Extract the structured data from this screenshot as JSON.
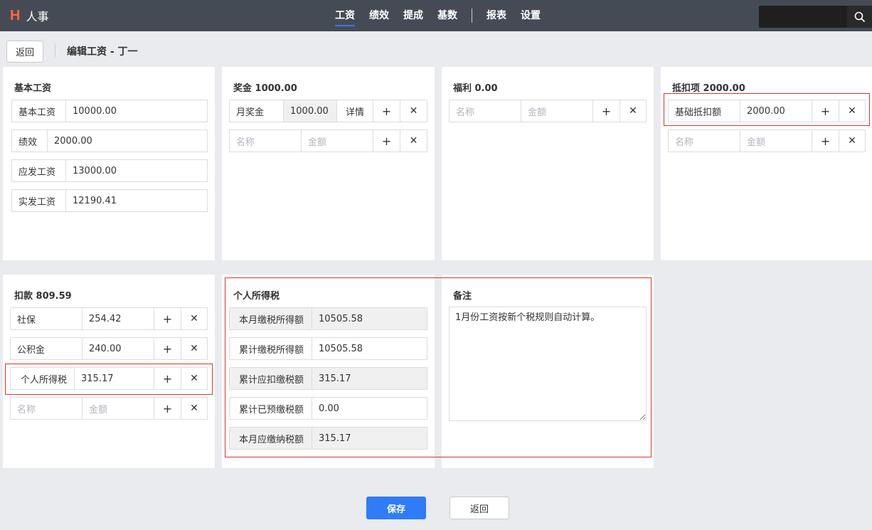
{
  "app": {
    "logo": "H",
    "name": "人事"
  },
  "nav": {
    "items": [
      "工资",
      "绩效",
      "提成",
      "基数"
    ],
    "items2": [
      "报表",
      "设置"
    ]
  },
  "header": {
    "back_label": "返回",
    "title": "编辑工资 - 丁一"
  },
  "basic": {
    "title": "基本工资",
    "rows": [
      {
        "label": "基本工资",
        "value": "10000.00"
      },
      {
        "label": "绩效",
        "value": "2000.00"
      },
      {
        "label": "应发工资",
        "value": "13000.00"
      },
      {
        "label": "实发工资",
        "value": "12190.41"
      }
    ]
  },
  "bonus": {
    "title": "奖金 1000.00",
    "item": {
      "name": "月奖金",
      "amount": "1000.00",
      "detail": "详情"
    },
    "new_name_ph": "名称",
    "new_amount_ph": "金额"
  },
  "welfare": {
    "title": "福利 0.00",
    "new_name_ph": "名称",
    "new_amount_ph": "金额"
  },
  "deductible": {
    "title": "抵扣项 2000.00",
    "item": {
      "name": "基础抵扣额",
      "amount": "2000.00"
    },
    "new_name_ph": "名称",
    "new_amount_ph": "金额"
  },
  "deduction": {
    "title": "扣款 809.59",
    "rows": [
      {
        "name": "社保",
        "amount": "254.42"
      },
      {
        "name": "公积金",
        "amount": "240.00"
      },
      {
        "name": "个人所得税",
        "amount": "315.17"
      }
    ],
    "new_name_ph": "名称",
    "new_amount_ph": "金额"
  },
  "tax": {
    "title": "个人所得税",
    "rows": [
      {
        "label": "本月缴税所得额",
        "value": "10505.58"
      },
      {
        "label": "累计缴税所得额",
        "value": "10505.58"
      },
      {
        "label": "累计应扣缴税额",
        "value": "315.17"
      },
      {
        "label": "累计已预缴税额",
        "value": "0.00"
      },
      {
        "label": "本月应缴纳税额",
        "value": "315.17"
      }
    ]
  },
  "remark": {
    "title": "备注",
    "text": "1月份工资按新个税规则自动计算。"
  },
  "footer": {
    "save_label": "保存",
    "back_label": "返回"
  }
}
